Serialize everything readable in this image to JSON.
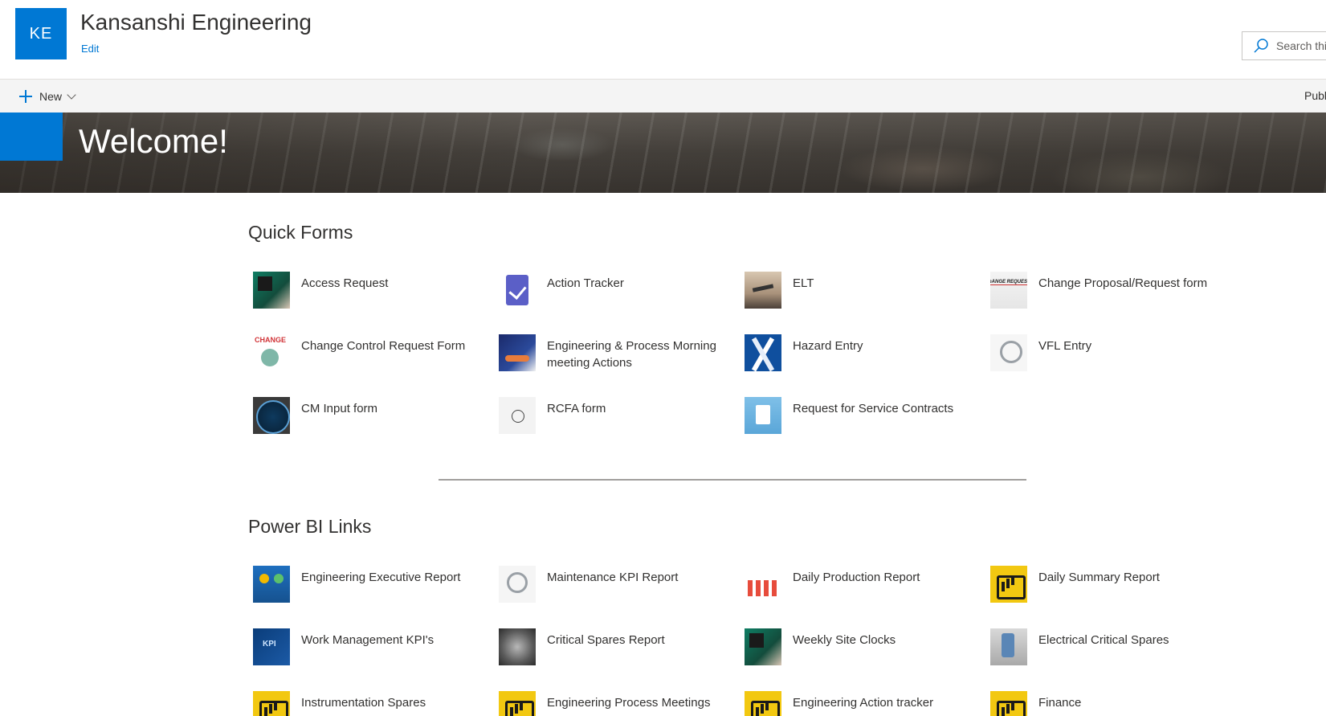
{
  "header": {
    "logo_initials": "KE",
    "site_title": "Kansanshi Engineering",
    "edit_label": "Edit",
    "search_placeholder": "Search thi"
  },
  "command_bar": {
    "new_label": "New",
    "publish_label": "Publ"
  },
  "banner": {
    "title": "Welcome!"
  },
  "quick_forms": {
    "title": "Quick Forms",
    "items": [
      {
        "label": "Access Request",
        "icon": "keypad-icon"
      },
      {
        "label": "Action Tracker",
        "icon": "clipboard-check-icon"
      },
      {
        "label": "ELT",
        "icon": "airplane-icon"
      },
      {
        "label": "Change Proposal/Request form",
        "icon": "change-request-icon"
      },
      {
        "label": "Change Control Request Form",
        "icon": "change-icon"
      },
      {
        "label": "Engineering & Process Morning meeting Actions",
        "icon": "team-meeting-icon"
      },
      {
        "label": "Hazard Entry",
        "icon": "hazard-logo-icon"
      },
      {
        "label": "VFL Entry",
        "icon": "magnifier-gears-icon"
      },
      {
        "label": "CM Input form",
        "icon": "condition-monitoring-icon"
      },
      {
        "label": "RCFA form",
        "icon": "flowchart-icon"
      },
      {
        "label": "Request for Service Contracts",
        "icon": "contract-icon"
      }
    ]
  },
  "power_bi_links": {
    "title": "Power BI Links",
    "items": [
      {
        "label": "Engineering Executive Report",
        "icon": "engineering-icon"
      },
      {
        "label": "Maintenance KPI Report",
        "icon": "magnifier-gears-icon"
      },
      {
        "label": "Daily Production Report",
        "icon": "production-icon"
      },
      {
        "label": "Daily Summary Report",
        "icon": "power-bi-icon"
      },
      {
        "label": "Work Management KPI's",
        "icon": "kpi-icon"
      },
      {
        "label": "Critical Spares Report",
        "icon": "gears-icon"
      },
      {
        "label": "Weekly Site Clocks",
        "icon": "keypad-icon"
      },
      {
        "label": "Electrical Critical Spares",
        "icon": "electrical-icon"
      },
      {
        "label": "Instrumentation Spares",
        "icon": "power-bi-icon"
      },
      {
        "label": "Engineering Process Meetings",
        "icon": "power-bi-icon"
      },
      {
        "label": "Engineering Action tracker",
        "icon": "power-bi-icon"
      },
      {
        "label": "Finance",
        "icon": "power-bi-icon"
      }
    ]
  },
  "colors": {
    "accent": "#0078d4",
    "power_bi_yellow": "#f2c811",
    "text": "#323130"
  }
}
